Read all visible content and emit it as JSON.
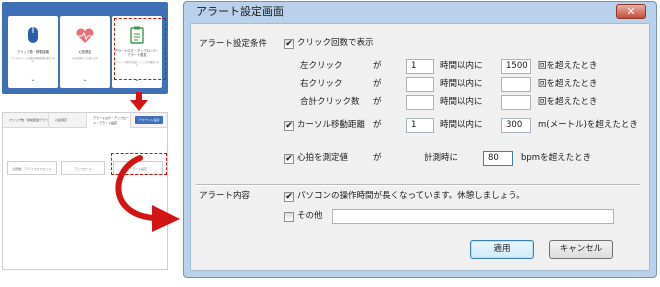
{
  "thumb_top": {
    "cards": [
      {
        "title": "クリック数・移動距離",
        "desc": "マウスのクリック回数や移動距離を設定します"
      },
      {
        "title": "心拍測定",
        "desc": "心拍を測定して記録します"
      },
      {
        "title": "アラートログ・アップロード・アラート設定",
        "desc": "アラートの条件を設定して、ログを確認します"
      }
    ]
  },
  "thumb_bottom": {
    "tabs": [
      "クリック数・移動距離グラフ",
      "心拍測定",
      "アラートログ・アップロード・アラート設定"
    ],
    "button": "アカウント設定",
    "selectors": [
      "記録数、デバイスやスロッド",
      "アップロード",
      "アラート設定"
    ]
  },
  "dialog": {
    "title": "アラート設定画面",
    "close_glyph": "✕",
    "conditions_label": "アラート設定条件",
    "click_checkbox": {
      "checked": true,
      "label": "クリック回数で表示"
    },
    "click_rows": [
      {
        "label": "左クリック",
        "ga": "が",
        "hours": "1",
        "within": "時間以内に",
        "count": "1500",
        "suffix": "回を超えたとき"
      },
      {
        "label": "右クリック",
        "ga": "が",
        "hours": "",
        "within": "時間以内に",
        "count": "",
        "suffix": "回を超えたとき"
      },
      {
        "label": "合計クリック数",
        "ga": "が",
        "hours": "",
        "within": "時間以内に",
        "count": "",
        "suffix": "回を超えたとき"
      }
    ],
    "cursor_row": {
      "checked": true,
      "label": "カーソル移動距離",
      "ga": "が",
      "hours": "1",
      "within": "時間以内に",
      "count": "300",
      "suffix": "m(メートル)を超えたとき"
    },
    "heart_row": {
      "checked": true,
      "label": "心拍を測定値",
      "ga": "が",
      "mid": "計測時に",
      "value": "80",
      "suffix": "bpmを超えたとき"
    },
    "content_label": "アラート内容",
    "message_checkbox": {
      "checked": true,
      "label": "パソコンの操作時間が長くなっています。休憩しましょう。"
    },
    "other_checkbox": {
      "checked": false,
      "label": "その他",
      "value": ""
    },
    "apply_button": "適用",
    "cancel_button": "キャンセル"
  },
  "colors": {
    "accent": "#3f6fb6",
    "highlight": "#cc1111",
    "dialog_frame": "#b9d1ea",
    "client_bg": "#f0f0f0"
  }
}
